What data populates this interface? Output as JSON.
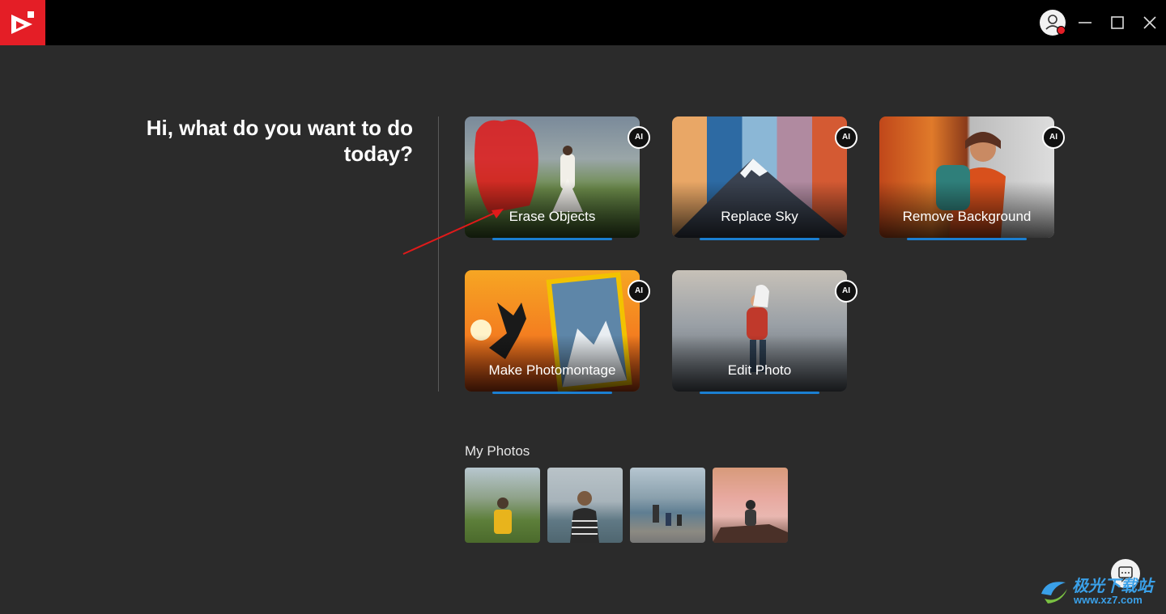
{
  "app": {
    "logo_icon": "app-logo-icon",
    "accent_color": "#e41e26",
    "highlight_color": "#1b7fd1"
  },
  "window_controls": {
    "user_icon": "user-account-icon",
    "minimize_icon": "minimize-icon",
    "maximize_icon": "maximize-icon",
    "close_icon": "close-icon"
  },
  "main": {
    "heading_line1": "Hi, what do you want to do",
    "heading_line2": "today?",
    "cards": [
      {
        "label": "Erase Objects",
        "badge": "AI"
      },
      {
        "label": "Replace Sky",
        "badge": "AI"
      },
      {
        "label": "Remove Background",
        "badge": "AI"
      },
      {
        "label": "Make Photomontage",
        "badge": "AI"
      },
      {
        "label": "Edit Photo",
        "badge": "AI"
      }
    ]
  },
  "my_photos": {
    "title": "My Photos",
    "photos": [
      {
        "icon": "photo-hiker-mountains"
      },
      {
        "icon": "photo-woman-sea"
      },
      {
        "icon": "photo-family-lake"
      },
      {
        "icon": "photo-person-clouds"
      }
    ]
  },
  "chat_icon": "chat-icon",
  "watermark": {
    "line1": "极光下载站",
    "line2": "www.xz7.com"
  }
}
